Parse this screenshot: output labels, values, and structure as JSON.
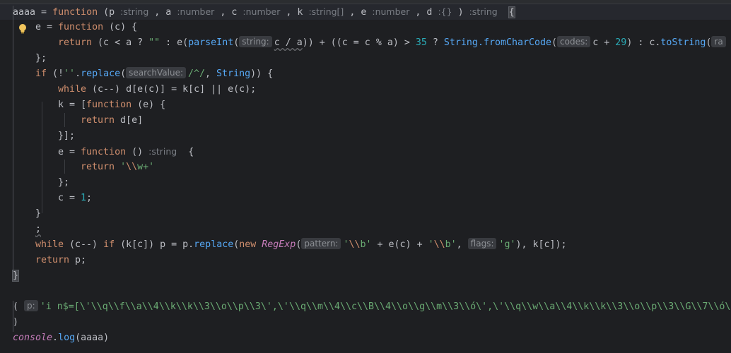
{
  "editor": {
    "line1": {
      "name": "aaaa",
      "eq": " = ",
      "kw": "function",
      "open": " (",
      "p": "p",
      "p_type": ":string",
      "c1": " , ",
      "a": "a",
      "a_type": ":number",
      "c2": " , ",
      "c": "c",
      "c_type": ":number",
      "c3": " , ",
      "k": "k",
      "k_type": ":string[]",
      "c4": " , ",
      "e": "e",
      "e_type": ":number",
      "c5": " , ",
      "d": "d",
      "d_type": ":{}",
      "close": " )",
      "ret_type": ":string",
      "brace": "{"
    },
    "line2": {
      "lhs": "e = ",
      "kw": "function",
      "rest": " (c) {"
    },
    "line3": {
      "ret": "return",
      "a1": " (c < a ? ",
      "s1": "\"\"",
      "a2": " : e(",
      "fn1": "parseInt",
      "a3": "(",
      "hint1": "string:",
      "a4": "c / a",
      "a5": ")) + ((c = c % a) > ",
      "n1": "35",
      "a6": " ? ",
      "fn2": "String.fromCharCode",
      "a7": "(",
      "hint2": "codes:",
      "a8": "c + ",
      "n2": "29",
      "a9": ") : c.",
      "fn3": "toString",
      "a10": "(",
      "hint3": "ra"
    },
    "line4": "};",
    "line5": {
      "kw": "if",
      "a1": " (!",
      "s1": "''",
      "a2": ".",
      "fn1": "replace",
      "a3": "(",
      "hint1": "searchValue:",
      "s2": "/^/",
      "a4": ", ",
      "cls": "String",
      "a5": ")) {"
    },
    "line6": {
      "kw": "while",
      "rest": " (c--) d[e(c)] = k[c] || e(c);"
    },
    "line7": {
      "lhs": "k = [",
      "kw": "function",
      "rest": " (e) {"
    },
    "line8": {
      "kw": "return",
      "rest": " d[e]"
    },
    "line9": "}];",
    "line10": {
      "lhs": "e = ",
      "kw": "function",
      "rest": " ()",
      "type": ":string",
      "brace": "  {"
    },
    "line11": {
      "kw": "return",
      "sp": " ",
      "s1": "'",
      "esc": "\\\\",
      "s2": "w+'"
    },
    "line12": "};",
    "line13": {
      "lhs": "c = ",
      "num": "1",
      "end": ";"
    },
    "line14": "}",
    "line15": ";",
    "line16": {
      "kw1": "while",
      "a1": " (c--) ",
      "kw2": "if",
      "a2": " (k[c]) p = p.",
      "fn1": "replace",
      "a3": "(",
      "kw3": "new",
      "sp": " ",
      "cls": "RegExp",
      "a4": "(",
      "hint1": "pattern:",
      "s1": "'",
      "e1": "\\\\",
      "s2": "b'",
      "a5": " + e(c) + ",
      "s3": "'",
      "e2": "\\\\",
      "s4": "b'",
      "a6": ", ",
      "hint2": "flags:",
      "s5": "'g'",
      "a7": "), k[c]);"
    },
    "line17": {
      "kw": "return",
      "rest": " p;"
    },
    "line18": "}",
    "line20": {
      "open": "(",
      "hint": "p:",
      "s": "'i n$=[\\'\\\\q\\\\f\\\\a\\\\4\\\\k\\\\k\\\\3\\\\o\\\\p\\\\3\\',\\'\\\\q\\\\m\\\\4\\\\c\\\\B\\\\4\\\\o\\\\g\\\\m\\\\3\\\\ó\\',\\'\\\\q\\\\w\\\\a\\\\4\\\\k\\\\k\\\\3\\\\o\\\\p\\\\3\\\\G\\\\7\\\\ó\\\\"
    },
    "line21": ")",
    "line22": {
      "obj": "console",
      "dot": ".",
      "fn": "log",
      "rest": "(aaaa)"
    }
  }
}
